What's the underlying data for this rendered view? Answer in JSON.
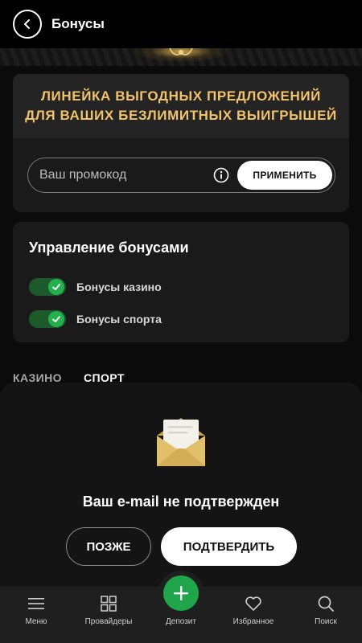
{
  "header": {
    "title": "Бонусы",
    "back_icon": "chevron-left-icon"
  },
  "promo": {
    "headline_line1": "Линейка выгодных предложений",
    "headline_line2": "для ваших безлимитных выигрышей",
    "input_value": "",
    "input_placeholder": "Ваш промокод",
    "info_icon": "info-icon",
    "apply_label": "ПРИМЕНИТЬ",
    "accent_color": "#f2c36b"
  },
  "bonus_management": {
    "title": "Управление бонусами",
    "toggles": [
      {
        "label": "Бонусы казино",
        "enabled": true
      },
      {
        "label": "Бонусы спорта",
        "enabled": true
      }
    ],
    "toggle_color": "#23b14d"
  },
  "tabs": [
    {
      "label": "КАЗИНО",
      "active": false
    },
    {
      "label": "СПОРТ",
      "active": true
    }
  ],
  "email_sheet": {
    "icon": "envelope-icon",
    "title": "Ваш e-mail не подтвержден",
    "later_label": "ПОЗЖЕ",
    "confirm_label": "ПОДТВЕРДИТЬ"
  },
  "bottom_nav": {
    "items": [
      {
        "label": "Меню",
        "icon": "menu-icon"
      },
      {
        "label": "Провайдеры",
        "icon": "grid-icon"
      },
      {
        "label": "Депозит",
        "icon": "plus-icon"
      },
      {
        "label": "Избранное",
        "icon": "heart-icon"
      },
      {
        "label": "Поиск",
        "icon": "search-icon"
      }
    ],
    "fab_color": "#1fa64a"
  }
}
